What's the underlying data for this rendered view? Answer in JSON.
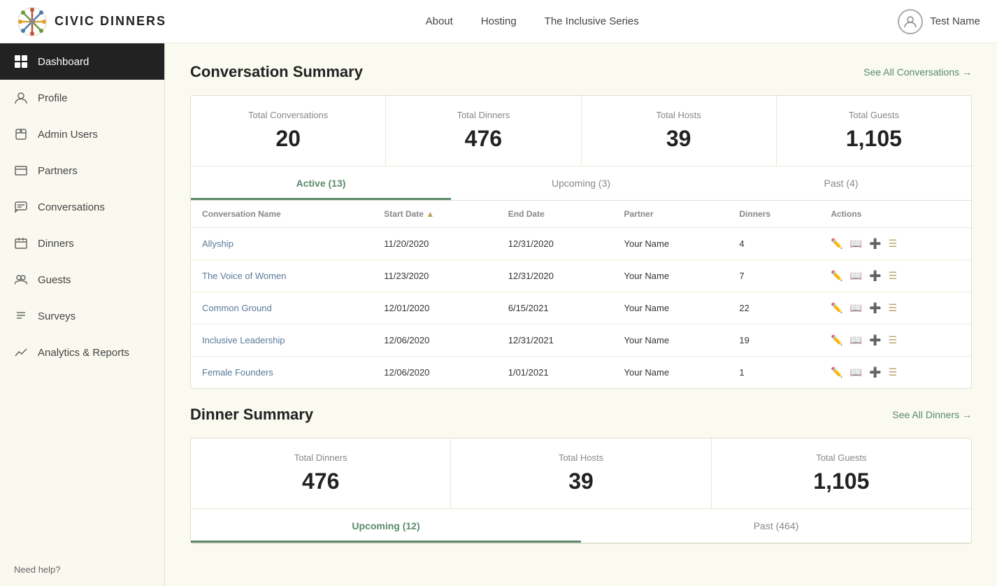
{
  "topnav": {
    "logo_text": "CIVIC DINNERS",
    "nav_links": [
      "About",
      "Hosting",
      "The Inclusive Series"
    ],
    "user_name": "Test Name"
  },
  "sidebar": {
    "items": [
      {
        "id": "dashboard",
        "label": "Dashboard",
        "active": true
      },
      {
        "id": "profile",
        "label": "Profile",
        "active": false
      },
      {
        "id": "admin-users",
        "label": "Admin Users",
        "active": false
      },
      {
        "id": "partners",
        "label": "Partners",
        "active": false
      },
      {
        "id": "conversations",
        "label": "Conversations",
        "active": false
      },
      {
        "id": "dinners",
        "label": "Dinners",
        "active": false
      },
      {
        "id": "guests",
        "label": "Guests",
        "active": false
      },
      {
        "id": "surveys",
        "label": "Surveys",
        "active": false
      },
      {
        "id": "analytics",
        "label": "Analytics & Reports",
        "active": false
      }
    ],
    "help_text": "Need help?"
  },
  "conversation_summary": {
    "title": "Conversation Summary",
    "see_all_label": "See All Conversations →",
    "stats": [
      {
        "label": "Total Conversations",
        "value": "20"
      },
      {
        "label": "Total Dinners",
        "value": "476"
      },
      {
        "label": "Total Hosts",
        "value": "39"
      },
      {
        "label": "Total Guests",
        "value": "1,105"
      }
    ],
    "tabs": [
      {
        "label": "Active (13)",
        "active": true
      },
      {
        "label": "Upcoming (3)",
        "active": false
      },
      {
        "label": "Past (4)",
        "active": false
      }
    ],
    "table": {
      "columns": [
        "Conversation Name",
        "Start Date",
        "End Date",
        "Partner",
        "Dinners",
        "Actions"
      ],
      "rows": [
        {
          "name": "Allyship",
          "start": "11/20/2020",
          "end": "12/31/2020",
          "partner": "Your Name",
          "dinners": "4"
        },
        {
          "name": "The Voice of Women",
          "start": "11/23/2020",
          "end": "12/31/2020",
          "partner": "Your Name",
          "dinners": "7"
        },
        {
          "name": "Common Ground",
          "start": "12/01/2020",
          "end": "6/15/2021",
          "partner": "Your Name",
          "dinners": "22"
        },
        {
          "name": "Inclusive Leadership",
          "start": "12/06/2020",
          "end": "12/31/2021",
          "partner": "Your Name",
          "dinners": "19"
        },
        {
          "name": "Female Founders",
          "start": "12/06/2020",
          "end": "1/01/2021",
          "partner": "Your Name",
          "dinners": "1"
        }
      ]
    }
  },
  "dinner_summary": {
    "title": "Dinner Summary",
    "see_all_label": "See All Dinners →",
    "stats": [
      {
        "label": "Total Dinners",
        "value": "476"
      },
      {
        "label": "Total Hosts",
        "value": "39"
      },
      {
        "label": "Total Guests",
        "value": "1,105"
      }
    ],
    "tabs": [
      {
        "label": "Upcoming (12)",
        "active": true
      },
      {
        "label": "Past (464)",
        "active": false
      }
    ]
  }
}
